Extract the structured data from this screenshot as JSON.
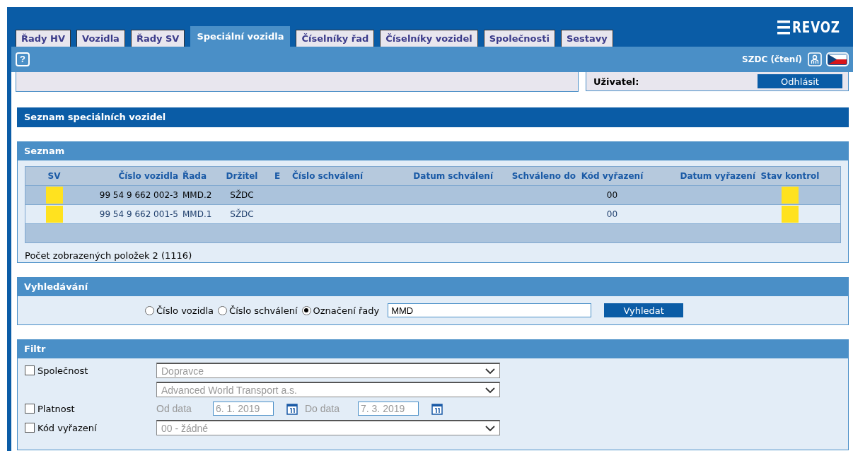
{
  "header": {
    "logo": "REVOZ",
    "tabs": [
      {
        "label": "Řady HV",
        "selected": false
      },
      {
        "label": "Vozidla",
        "selected": false
      },
      {
        "label": "Řady SV",
        "selected": false
      },
      {
        "label": "Speciální vozidla",
        "selected": true
      },
      {
        "label": "Číselníky řad",
        "selected": false
      },
      {
        "label": "Číselníky vozidel",
        "selected": false
      },
      {
        "label": "Společnosti",
        "selected": false
      },
      {
        "label": "Sestavy",
        "selected": false
      }
    ]
  },
  "toolbar": {
    "help": "?",
    "user_role": "SZDC (čtení)"
  },
  "user_panel": {
    "label": "Uživatel:",
    "logout_button": "Odhlásit"
  },
  "page_title": "Seznam speciálních vozidel",
  "list": {
    "title": "Seznam",
    "columns": [
      "SV",
      "Číslo vozidla",
      "Řada",
      "Držitel",
      "E",
      "Číslo schválení",
      "Datum schválení",
      "Schváleno do",
      "Kód vyřazení",
      "Datum vyřazení",
      "Stav kontrol"
    ],
    "rows": [
      {
        "sv_status": {
          "color": "#ffe21f"
        },
        "vehicle_number": "99 54 9 662 002-3",
        "series": "MMD.2",
        "holder": "SŽDC",
        "withdrawal_code": "00",
        "control_status": {
          "color": "#ffe21f"
        }
      },
      {
        "sv_status": {
          "color": "#ffe21f"
        },
        "vehicle_number": "99 54 9 662 001-5",
        "series": "MMD.1",
        "holder": "SŽDC",
        "withdrawal_code": "00",
        "control_status": {
          "color": "#ffe21f"
        }
      }
    ],
    "count": "Počet zobrazených položek 2 (1116)"
  },
  "search": {
    "title": "Vyhledávání",
    "options": [
      {
        "label": "Číslo vozidla",
        "selected": false
      },
      {
        "label": "Číslo schválení",
        "selected": false
      },
      {
        "label": "Označení řady",
        "selected": true
      }
    ],
    "value": "MMD",
    "button": "Vyhledat"
  },
  "filter": {
    "title": "Filtr",
    "fields": [
      {
        "kind": "selects",
        "label": "Společnost",
        "checked": false,
        "disabled": true,
        "selects": [
          "Dopravce",
          "Advanced World Transport a.s."
        ]
      },
      {
        "kind": "date-range",
        "label": "Platnost",
        "checked": false,
        "disabled": true,
        "from_label": "Od data",
        "from_value": "6. 1. 2019",
        "to_label": "Do data",
        "to_value": "7. 3. 2019"
      },
      {
        "kind": "selects",
        "label": "Kód vyřazení",
        "checked": false,
        "disabled": true,
        "selects": [
          "00 - žádné"
        ]
      }
    ]
  }
}
